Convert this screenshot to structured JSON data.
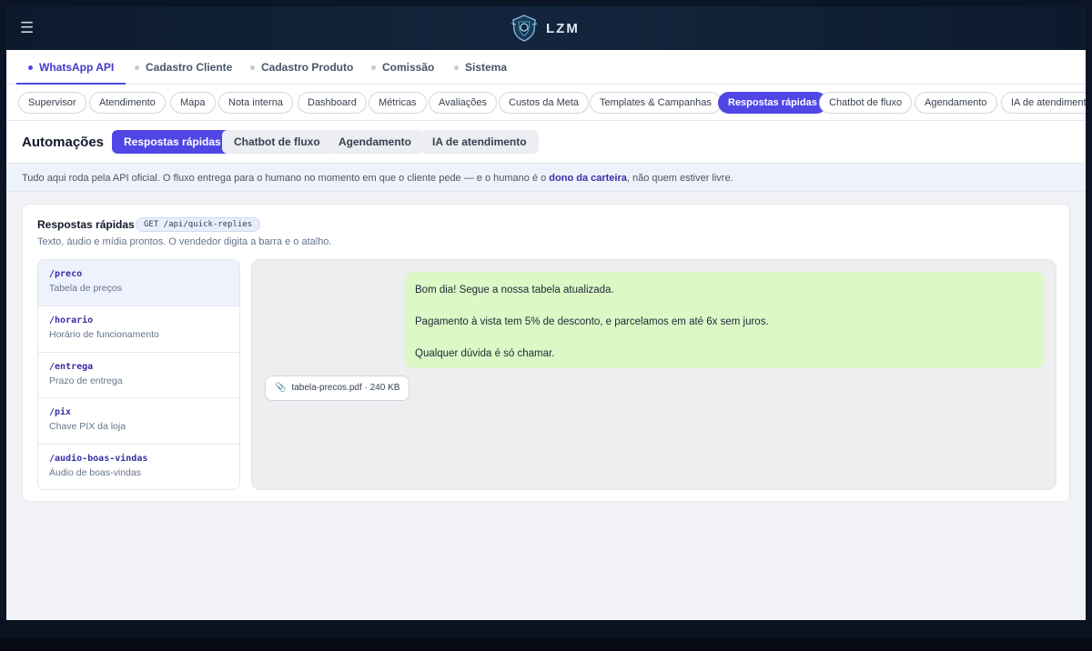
{
  "header": {
    "brand": "LZM",
    "menu_icon": "hamburger-menu-icon",
    "logo_icon": "shield-logo-icon",
    "colors": {
      "bg": "#0c1a2e",
      "accent": "#4f46e5"
    }
  },
  "modules": [
    {
      "label": "WhatsApp API",
      "active": true
    },
    {
      "label": "Cadastro Cliente"
    },
    {
      "label": "Cadastro Produto"
    },
    {
      "label": "Comissão"
    },
    {
      "label": "Sistema"
    }
  ],
  "pills": [
    {
      "label": "Supervisor"
    },
    {
      "label": "Atendimento"
    },
    {
      "label": "Mapa"
    },
    {
      "label": "Nota interna"
    },
    {
      "label": "Dashboard"
    },
    {
      "label": "Métricas"
    },
    {
      "label": "Avaliações"
    },
    {
      "label": "Custos da Meta"
    },
    {
      "label": "Templates & Campanhas"
    },
    {
      "label": "Respostas rápidas",
      "active": true
    },
    {
      "label": "Chatbot de fluxo"
    },
    {
      "label": "Agendamento"
    },
    {
      "label": "IA de atendimento"
    }
  ],
  "automations": {
    "title": "Automações",
    "tabs": [
      {
        "label": "Respostas rápidas",
        "active": true
      },
      {
        "label": "Chatbot de fluxo"
      },
      {
        "label": "Agendamento"
      },
      {
        "label": "IA de atendimento"
      }
    ]
  },
  "info": {
    "before": "Tudo aqui roda pela API oficial. O fluxo entrega para o humano no momento em que o cliente pede — e o humano é o ",
    "bold": "dono da carteira",
    "after": ", não quem estiver livre."
  },
  "card": {
    "title": "Respostas rápidas",
    "endpoint": "GET /api/quick-replies",
    "subtitle": "Texto, áudio e mídia prontos. O vendedor digita a barra e o atalho."
  },
  "replies": [
    {
      "cmd": "/preco",
      "desc": "Tabela de preços",
      "active": true
    },
    {
      "cmd": "/horario",
      "desc": "Horário de funcionamento"
    },
    {
      "cmd": "/entrega",
      "desc": "Prazo de entrega"
    },
    {
      "cmd": "/pix",
      "desc": "Chave PIX da loja"
    },
    {
      "cmd": "/audio-boas-vindas",
      "desc": "Áudio de boas-vindas"
    }
  ],
  "preview": {
    "lines": [
      "Bom dia! Segue a nossa tabela atualizada.",
      "Pagamento à vista tem 5% de desconto, e parcelamos em até 6x sem juros.",
      "Qualquer dúvida é só chamar."
    ],
    "attachment_icon": "paperclip-icon",
    "attachment": "tabela-precos.pdf · 240 KB"
  }
}
